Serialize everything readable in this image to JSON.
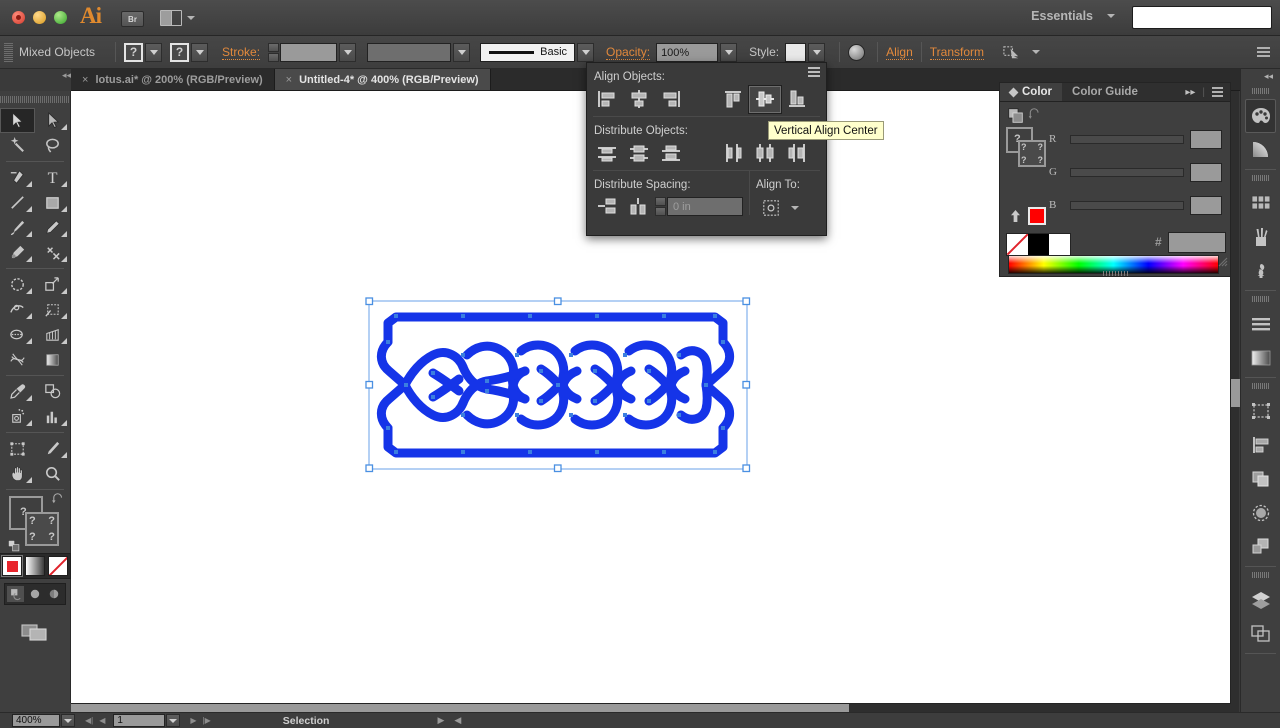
{
  "app": {
    "name": "Adobe Illustrator",
    "logo_text": "Ai",
    "bridge_label": "Br",
    "workspace_label": "Essentials"
  },
  "control_bar": {
    "selection_label": "Mixed Objects",
    "fill_placeholder": "?",
    "stroke_placeholder": "?",
    "stroke_label": "Stroke:",
    "stroke_profile_label": "Basic",
    "opacity_label": "Opacity:",
    "opacity_value": "100%",
    "style_label": "Style:",
    "align_label": "Align",
    "transform_label": "Transform"
  },
  "tabs": [
    {
      "label": "lotus.ai* @ 200% (RGB/Preview)",
      "close": "×",
      "active": false
    },
    {
      "label": "Untitled-4* @ 400% (RGB/Preview)",
      "close": "×",
      "active": true
    }
  ],
  "align_panel": {
    "align_objects_title": "Align Objects:",
    "distribute_objects_title": "Distribute Objects:",
    "distribute_spacing_title": "Distribute Spacing:",
    "align_to_title": "Align To:",
    "spacing_value": "0 in",
    "align_objects": [
      {
        "name": "horizontal-align-left",
        "active": false
      },
      {
        "name": "horizontal-align-center",
        "active": false
      },
      {
        "name": "horizontal-align-right",
        "active": false
      },
      {
        "name": "vertical-align-top",
        "active": false
      },
      {
        "name": "vertical-align-center",
        "active": true
      },
      {
        "name": "vertical-align-bottom",
        "active": false
      }
    ],
    "distribute_objects": [
      {
        "name": "vertical-distribute-top",
        "active": false
      },
      {
        "name": "vertical-distribute-center",
        "active": false
      },
      {
        "name": "vertical-distribute-bottom",
        "active": false
      },
      {
        "name": "horizontal-distribute-left",
        "active": false
      },
      {
        "name": "horizontal-distribute-center",
        "active": false
      },
      {
        "name": "horizontal-distribute-right",
        "active": false
      }
    ]
  },
  "tooltip": {
    "text": "Vertical Align Center",
    "background": "#ffffcc"
  },
  "color_panel": {
    "tabs": [
      {
        "label": "Color",
        "active": true
      },
      {
        "label": "Color Guide",
        "active": false
      }
    ],
    "channels": [
      "R",
      "G",
      "B"
    ],
    "hex_label": "#",
    "hex_value": "",
    "r_value": "",
    "g_value": "",
    "b_value": "",
    "out_of_gamut_color": "#ff0000",
    "swatch_none": "none-swatch",
    "swatch_black": "#000000",
    "swatch_white": "#ffffff"
  },
  "toolbar": {
    "tools": [
      {
        "name": "selection-tool",
        "selected": true,
        "has_flyout": false
      },
      {
        "name": "direct-selection-tool",
        "selected": false,
        "has_flyout": true
      },
      {
        "name": "magic-wand-tool",
        "selected": false,
        "has_flyout": false
      },
      {
        "name": "lasso-tool",
        "selected": false,
        "has_flyout": false
      },
      {
        "name": "pen-tool",
        "selected": false,
        "has_flyout": true
      },
      {
        "name": "type-tool",
        "selected": false,
        "has_flyout": true
      },
      {
        "name": "line-segment-tool",
        "selected": false,
        "has_flyout": true
      },
      {
        "name": "rectangle-tool",
        "selected": false,
        "has_flyout": true
      },
      {
        "name": "paintbrush-tool",
        "selected": false,
        "has_flyout": true
      },
      {
        "name": "pencil-tool",
        "selected": false,
        "has_flyout": true
      },
      {
        "name": "blob-brush-tool",
        "selected": false,
        "has_flyout": true
      },
      {
        "name": "eraser-tool",
        "selected": false,
        "has_flyout": true
      },
      {
        "name": "rotate-tool",
        "selected": false,
        "has_flyout": true
      },
      {
        "name": "scale-tool",
        "selected": false,
        "has_flyout": true
      },
      {
        "name": "width-tool",
        "selected": false,
        "has_flyout": true
      },
      {
        "name": "free-transform-tool",
        "selected": false,
        "has_flyout": true
      },
      {
        "name": "shape-builder-tool",
        "selected": false,
        "has_flyout": true
      },
      {
        "name": "perspective-grid-tool",
        "selected": false,
        "has_flyout": true
      },
      {
        "name": "mesh-tool",
        "selected": false,
        "has_flyout": false
      },
      {
        "name": "gradient-tool",
        "selected": false,
        "has_flyout": false
      },
      {
        "name": "eyedropper-tool",
        "selected": false,
        "has_flyout": true
      },
      {
        "name": "blend-tool",
        "selected": false,
        "has_flyout": false
      },
      {
        "name": "symbol-sprayer-tool",
        "selected": false,
        "has_flyout": true
      },
      {
        "name": "column-graph-tool",
        "selected": false,
        "has_flyout": true
      },
      {
        "name": "artboard-tool",
        "selected": false,
        "has_flyout": false
      },
      {
        "name": "slice-tool",
        "selected": false,
        "has_flyout": true
      },
      {
        "name": "hand-tool",
        "selected": false,
        "has_flyout": true
      },
      {
        "name": "zoom-tool",
        "selected": false,
        "has_flyout": false
      }
    ],
    "fill_stroke_placeholder": "?",
    "paint_modes": [
      {
        "name": "fill-color-mode",
        "selected": true
      },
      {
        "name": "gradient-mode",
        "selected": false
      },
      {
        "name": "none-mode",
        "selected": false
      }
    ],
    "draw_modes": [
      {
        "name": "draw-normal-mode",
        "selected": true
      },
      {
        "name": "draw-behind-mode",
        "selected": false
      },
      {
        "name": "draw-inside-mode",
        "selected": false
      }
    ],
    "screen_mode": "change-screen-mode"
  },
  "dock": [
    {
      "name": "color-panel-icon",
      "selected": true
    },
    {
      "name": "color-guide-icon",
      "selected": false
    },
    {
      "name": "swatches-icon",
      "selected": false
    },
    {
      "name": "brushes-icon",
      "selected": false
    },
    {
      "name": "symbols-icon",
      "selected": false
    },
    {
      "name": "stroke-icon",
      "selected": false
    },
    {
      "name": "gradient-icon",
      "selected": false
    },
    {
      "name": "transform-icon",
      "selected": false
    },
    {
      "name": "align-icon",
      "selected": false
    },
    {
      "name": "pathfinder-icon",
      "selected": false
    },
    {
      "name": "transparency-icon",
      "selected": false
    },
    {
      "name": "appearance-icon",
      "selected": false
    },
    {
      "name": "layers-icon",
      "selected": false
    },
    {
      "name": "artboards-icon",
      "selected": false
    }
  ],
  "artwork": {
    "name": "celtic-knot-artwork",
    "fill_color": "#1534e8",
    "anchor_color": "#3b7fe0",
    "selection_color": "#4a90e2"
  },
  "status_bar": {
    "zoom_value": "400%",
    "page_value": "1",
    "status_text": "Selection"
  }
}
